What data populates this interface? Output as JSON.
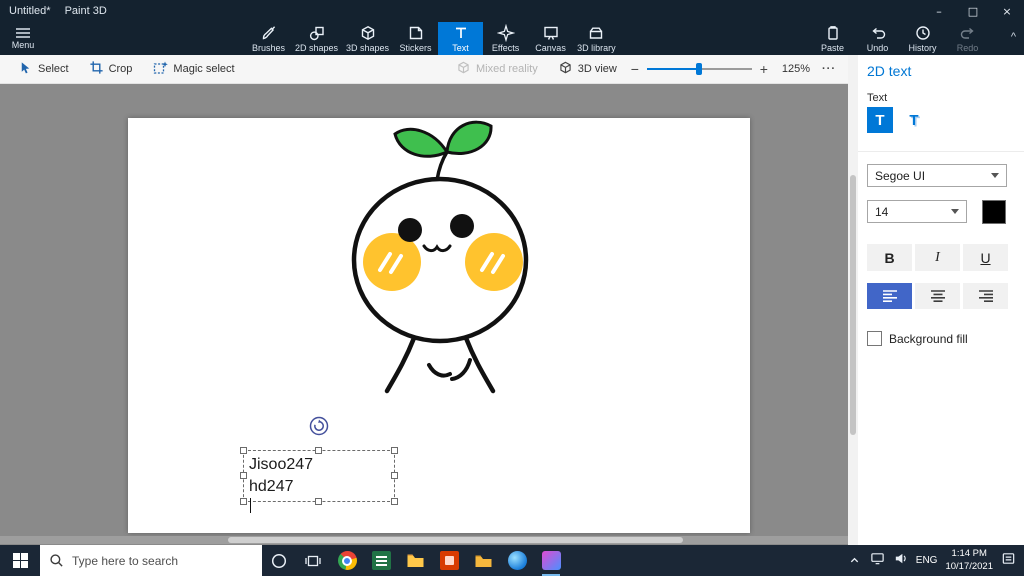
{
  "titlebar": {
    "doc_title": "Untitled*",
    "app_name": "Paint 3D",
    "minimize": "–",
    "maximize": "□",
    "close": "×"
  },
  "ribbon": {
    "menu_label": "Menu",
    "collapse": "^",
    "tools": [
      {
        "label": "Brushes"
      },
      {
        "label": "2D shapes"
      },
      {
        "label": "3D shapes"
      },
      {
        "label": "Stickers"
      },
      {
        "label": "Text"
      },
      {
        "label": "Effects"
      },
      {
        "label": "Canvas"
      },
      {
        "label": "3D library"
      }
    ],
    "right_tools": [
      {
        "label": "Paste"
      },
      {
        "label": "Undo"
      },
      {
        "label": "History"
      },
      {
        "label": "Redo"
      }
    ]
  },
  "toolbar": {
    "select_label": "Select",
    "crop_label": "Crop",
    "magic_select_label": "Magic select",
    "mixed_reality_label": "Mixed reality",
    "view3d_label": "3D view",
    "zoom_out": "−",
    "zoom_in": "+",
    "zoom_level": "125%",
    "more": "···"
  },
  "canvas": {
    "text_lines": [
      "Jisoo247",
      "hd247"
    ]
  },
  "panel": {
    "title": "2D text",
    "section_label": "Text",
    "text_2d_glyph": "T",
    "text_3d_glyph": "T",
    "font_name": "Segoe UI",
    "font_size": "14",
    "bold_label": "B",
    "italic_label": "I",
    "underline_label": "U",
    "background_fill_label": "Background fill"
  },
  "taskbar": {
    "search_placeholder": "Type here to search",
    "language": "ENG",
    "time": "1:14 PM",
    "date": "10/17/2021"
  },
  "colors": {
    "accent_blue": "#0078d7",
    "titlebar_bg": "#14222f",
    "align_selected_bg": "#4166c8",
    "cheek_yellow": "#ffc32e",
    "leaf_green": "#3fbf4e",
    "taskbar_bg": "#1b2736"
  }
}
